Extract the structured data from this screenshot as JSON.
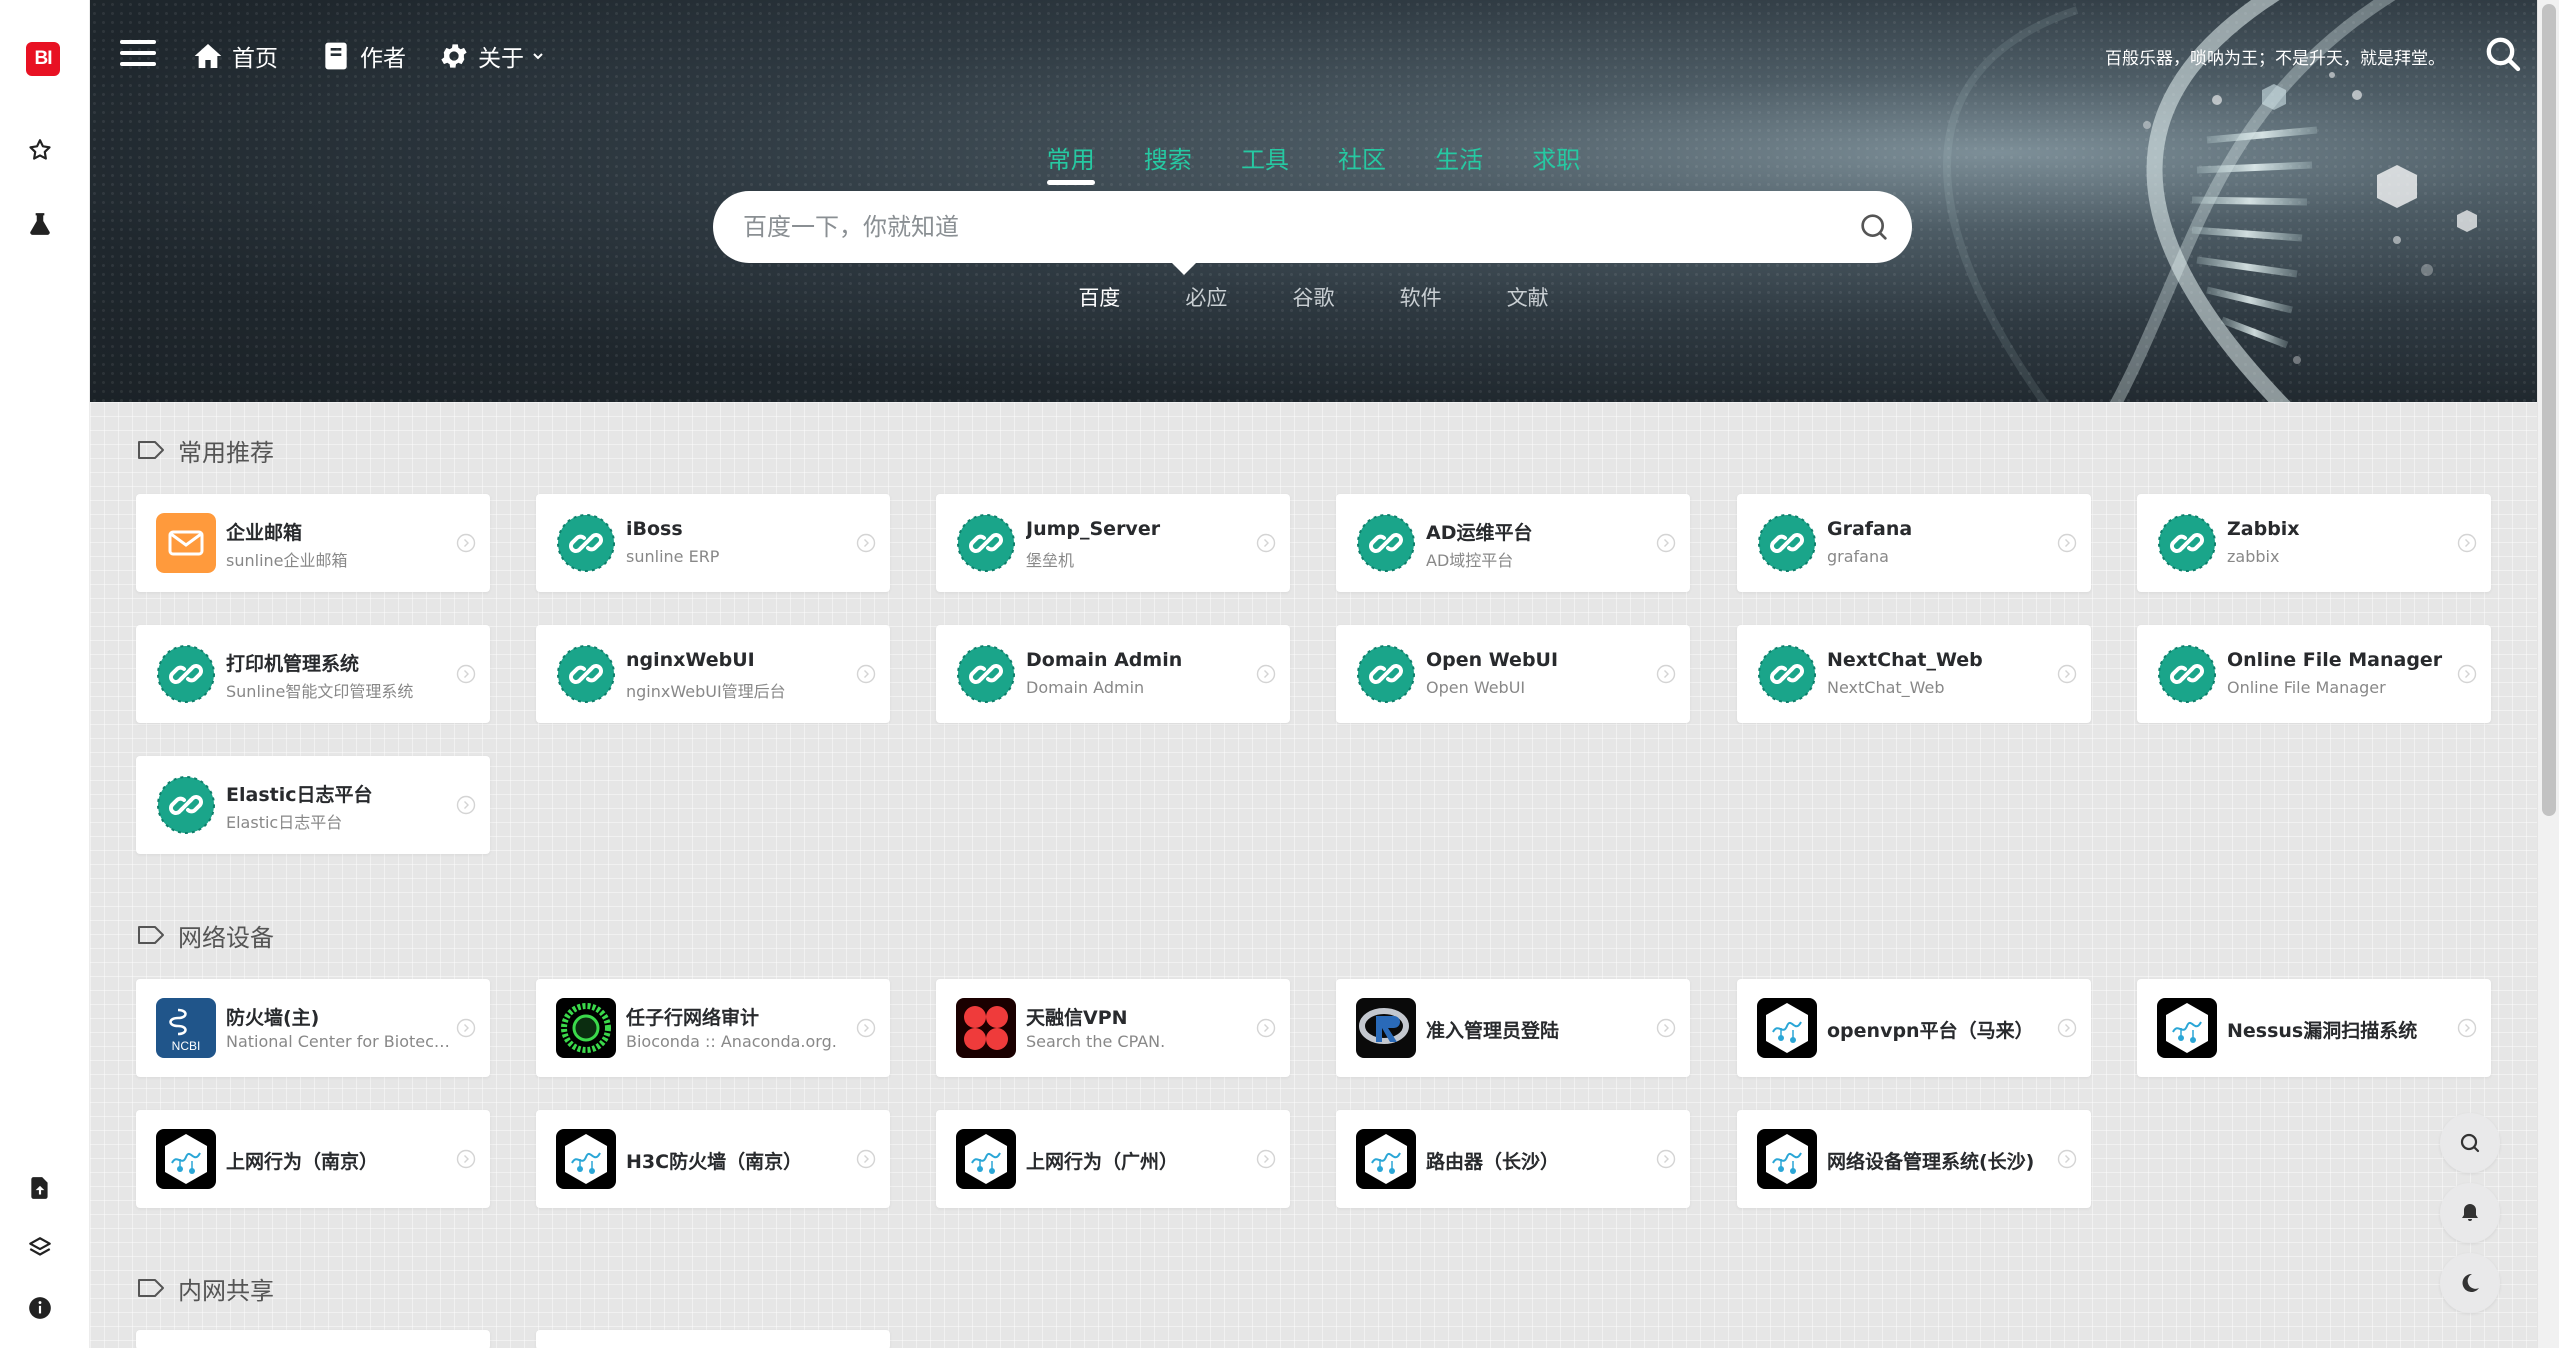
{
  "sidebar": {
    "logo_text": "BI",
    "top_icons": [
      "star-icon",
      "flask-icon"
    ],
    "bottom_icons": [
      "file-upload-icon",
      "layers-icon",
      "info-icon"
    ]
  },
  "topbar": {
    "nav": [
      {
        "label": "首页",
        "icon": "home-icon"
      },
      {
        "label": "作者",
        "icon": "book-icon"
      },
      {
        "label": "关于",
        "icon": "gear-icon"
      }
    ],
    "motto": "百般乐器，唢呐为王；不是升天，就是拜堂。"
  },
  "search": {
    "tabs": [
      "常用",
      "搜索",
      "工具",
      "社区",
      "生活",
      "求职"
    ],
    "active_tab": "常用",
    "placeholder": "百度一下，你就知道",
    "engines": [
      "百度",
      "必应",
      "谷歌",
      "软件",
      "文献"
    ],
    "active_engine": "百度"
  },
  "sections": [
    {
      "title": "常用推荐",
      "cards": [
        {
          "title": "企业邮箱",
          "desc": "sunline企业邮箱",
          "icon": "mail-icon"
        },
        {
          "title": "iBoss",
          "desc": "sunline ERP",
          "icon": "link-icon"
        },
        {
          "title": "Jump_Server",
          "desc": "堡垒机",
          "icon": "link-icon"
        },
        {
          "title": "AD运维平台",
          "desc": "AD域控平台",
          "icon": "link-icon"
        },
        {
          "title": "Grafana",
          "desc": "grafana",
          "icon": "link-icon"
        },
        {
          "title": "Zabbix",
          "desc": "zabbix",
          "icon": "link-icon"
        },
        {
          "title": "打印机管理系统",
          "desc": "Sunline智能文印管理系统",
          "icon": "link-icon"
        },
        {
          "title": "nginxWebUI",
          "desc": "nginxWebUI管理后台",
          "icon": "link-icon"
        },
        {
          "title": "Domain Admin",
          "desc": "Domain Admin",
          "icon": "link-icon"
        },
        {
          "title": "Open WebUI",
          "desc": "Open WebUI",
          "icon": "link-icon"
        },
        {
          "title": "NextChat_Web",
          "desc": "NextChat_Web",
          "icon": "link-icon"
        },
        {
          "title": "Online File Manager",
          "desc": "Online File Manager",
          "icon": "link-icon"
        },
        {
          "title": "Elastic日志平台",
          "desc": "Elastic日志平台",
          "icon": "link-icon"
        }
      ]
    },
    {
      "title": "网络设备",
      "cards": [
        {
          "title": "防火墙(主)",
          "desc": "National Center for Biotechn...",
          "icon": "ncbi-icon",
          "icon_text": "NCBI"
        },
        {
          "title": "任子行网络审计",
          "desc": "Bioconda :: Anaconda.org.",
          "icon": "bioconda-icon"
        },
        {
          "title": "天融信VPN",
          "desc": "Search the CPAN.",
          "icon": "cpan-icon"
        },
        {
          "title": "准入管理员登陆",
          "desc": "",
          "icon": "r-logo-icon"
        },
        {
          "title": "openvpn平台（马来）",
          "desc": "",
          "icon": "hexagon-logo-icon"
        },
        {
          "title": "Nessus漏洞扫描系统",
          "desc": "",
          "icon": "hexagon-logo-icon"
        },
        {
          "title": "上网行为（南京）",
          "desc": "",
          "icon": "hexagon-logo-icon"
        },
        {
          "title": "H3C防火墙（南京）",
          "desc": "",
          "icon": "hexagon-logo-icon"
        },
        {
          "title": "上网行为（广州）",
          "desc": "",
          "icon": "hexagon-logo-icon"
        },
        {
          "title": "路由器（长沙）",
          "desc": "",
          "icon": "hexagon-logo-icon"
        },
        {
          "title": "网络设备管理系统(长沙)",
          "desc": "",
          "icon": "hexagon-logo-icon"
        }
      ]
    },
    {
      "title": "内网共享",
      "cards": []
    }
  ],
  "floating_buttons": [
    "search-icon",
    "bell-icon",
    "moon-icon"
  ],
  "colors": {
    "accent": "#26c9a2",
    "card_icon_teal": "#1aa58a",
    "mail_orange": "#ff9a3c",
    "logo_red": "#e81123"
  }
}
